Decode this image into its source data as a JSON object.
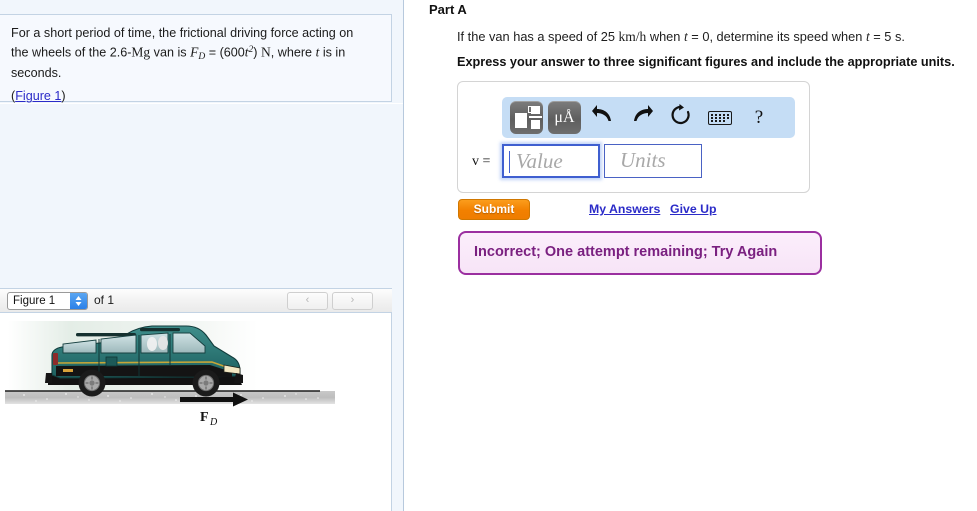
{
  "problem": {
    "line1": "For a short period of time, the frictional driving force acting on",
    "line2_pre": "the wheels of the 2.6-",
    "line2_unit": "Mg",
    "line2_mid": " van is ",
    "force_symbol": "F",
    "force_sub": "D",
    "force_eq": " = (600",
    "force_t": "t",
    "force_exp": "2",
    "force_close": ") ",
    "force_unit": "N",
    "line2_post": ", where ",
    "var_t": "t",
    "line2_end": " is in",
    "line3": "seconds.",
    "figure_link_open": "(",
    "figure_link": "Figure 1",
    "figure_link_close": ")"
  },
  "figure_bar": {
    "select_value": "Figure 1",
    "select_arrow": "▴▾",
    "count_label": "of 1",
    "prev_label": "‹",
    "next_label": "›"
  },
  "figure": {
    "force_label": "F",
    "force_label_sub": "D"
  },
  "part": {
    "title": "Part A",
    "question_pre": "If the van has a speed of 25 ",
    "question_unit": "km/h",
    "question_mid": " when ",
    "question_t1": "t",
    "question_eq1": " = 0, determine its speed when ",
    "question_t2": "t",
    "question_eq2": " = 5 s.",
    "instruction": "Express your answer to three significant figures and include the appropriate units."
  },
  "answer": {
    "variable": "v =",
    "value_placeholder": "Value",
    "units_placeholder": "Units",
    "value_text": "",
    "units_text": "",
    "toolbar": {
      "template_icon": "math-template-icon",
      "units_label": "μÅ",
      "undo_icon": "⬅",
      "redo_icon": "➡",
      "reset_icon": "↻",
      "keyboard_icon": "keyboard-icon",
      "help_label": "?"
    }
  },
  "actions": {
    "submit_label": "Submit",
    "my_answers_label": "My Answers",
    "give_up_label": "Give Up"
  },
  "feedback": {
    "message": "Incorrect; One attempt remaining; Try Again",
    "color": "#7a2080",
    "border_color": "#9b2fa0"
  },
  "colors": {
    "submit_orange": "#f28000",
    "link_blue": "#2b2bc8",
    "panel_blue": "#f1f6fc",
    "mathbar_blue": "#c5ddf5"
  }
}
